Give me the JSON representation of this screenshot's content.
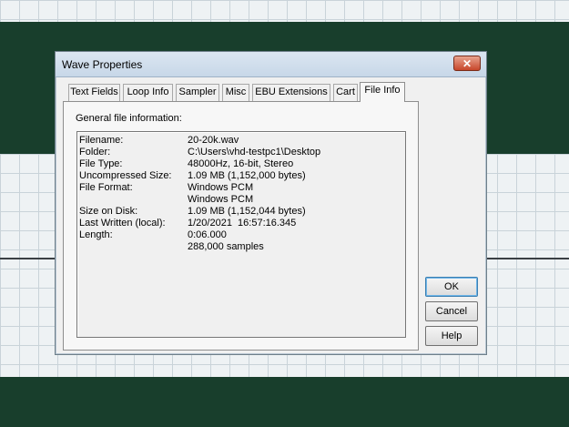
{
  "dialog": {
    "title": "Wave Properties",
    "close_glyph": "✕"
  },
  "tabs": [
    {
      "label": "Text Fields"
    },
    {
      "label": "Loop Info"
    },
    {
      "label": "Sampler"
    },
    {
      "label": "Misc"
    },
    {
      "label": "EBU Extensions"
    },
    {
      "label": "Cart"
    },
    {
      "label": "File Info",
      "active": true
    }
  ],
  "file_info": {
    "section_label": "General file information:",
    "rows": [
      {
        "label": "Filename:",
        "value": "20-20k.wav"
      },
      {
        "label": "Folder:",
        "value": "C:\\Users\\vhd-testpc1\\Desktop"
      },
      {
        "label": "File Type:",
        "value": "48000Hz, 16-bit, Stereo"
      },
      {
        "label": "Uncompressed Size:",
        "value": "1.09 MB (1,152,000 bytes)"
      },
      {
        "label": "File Format:",
        "value": "Windows PCM"
      },
      {
        "label": "",
        "value": "Windows PCM"
      },
      {
        "label": "Size on Disk:",
        "value": "1.09 MB (1,152,044 bytes)"
      },
      {
        "label": "Last Written (local):",
        "value": "1/20/2021  16:57:16.345"
      },
      {
        "label": "Length:",
        "value": "0:06.000"
      },
      {
        "label": "",
        "value": "288,000 samples"
      }
    ]
  },
  "buttons": {
    "ok": "OK",
    "cancel": "Cancel",
    "help": "Help"
  }
}
